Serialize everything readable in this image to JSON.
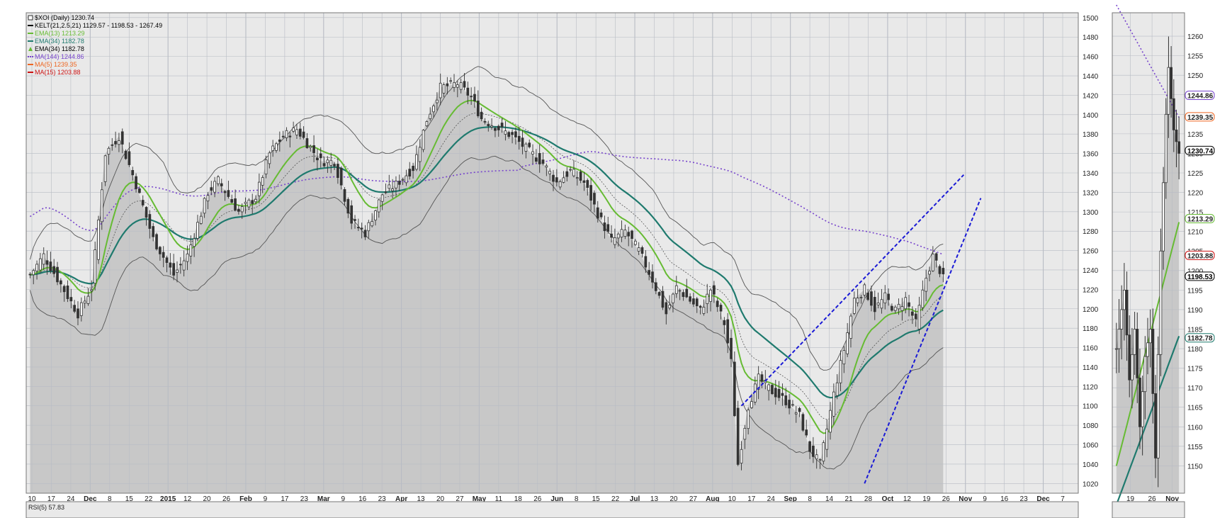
{
  "chart_data": [
    {
      "type": "candlestick",
      "title": "$XOI (Daily) 1230.74",
      "ylim": [
        1010,
        1505
      ],
      "yticks": [
        1020,
        1040,
        1060,
        1080,
        1100,
        1120,
        1140,
        1160,
        1180,
        1200,
        1220,
        1240,
        1260,
        1280,
        1300,
        1320,
        1340,
        1360,
        1380,
        1400,
        1420,
        1440,
        1460,
        1480,
        1500
      ],
      "xticks": [
        {
          "label": "10",
          "bold": false
        },
        {
          "label": "17",
          "bold": false
        },
        {
          "label": "24",
          "bold": false
        },
        {
          "label": "Dec",
          "bold": true
        },
        {
          "label": "8",
          "bold": false
        },
        {
          "label": "15",
          "bold": false
        },
        {
          "label": "22",
          "bold": false
        },
        {
          "label": "2015",
          "bold": true
        },
        {
          "label": "12",
          "bold": false
        },
        {
          "label": "20",
          "bold": false
        },
        {
          "label": "26",
          "bold": false
        },
        {
          "label": "Feb",
          "bold": true
        },
        {
          "label": "9",
          "bold": false
        },
        {
          "label": "17",
          "bold": false
        },
        {
          "label": "23",
          "bold": false
        },
        {
          "label": "Mar",
          "bold": true
        },
        {
          "label": "9",
          "bold": false
        },
        {
          "label": "16",
          "bold": false
        },
        {
          "label": "23",
          "bold": false
        },
        {
          "label": "Apr",
          "bold": true
        },
        {
          "label": "13",
          "bold": false
        },
        {
          "label": "20",
          "bold": false
        },
        {
          "label": "27",
          "bold": false
        },
        {
          "label": "May",
          "bold": true
        },
        {
          "label": "11",
          "bold": false
        },
        {
          "label": "18",
          "bold": false
        },
        {
          "label": "26",
          "bold": false
        },
        {
          "label": "Jun",
          "bold": true
        },
        {
          "label": "8",
          "bold": false
        },
        {
          "label": "15",
          "bold": false
        },
        {
          "label": "22",
          "bold": false
        },
        {
          "label": "Jul",
          "bold": true
        },
        {
          "label": "13",
          "bold": false
        },
        {
          "label": "20",
          "bold": false
        },
        {
          "label": "27",
          "bold": false
        },
        {
          "label": "Aug",
          "bold": true
        },
        {
          "label": "10",
          "bold": false
        },
        {
          "label": "17",
          "bold": false
        },
        {
          "label": "24",
          "bold": false
        },
        {
          "label": "Sep",
          "bold": true
        },
        {
          "label": "8",
          "bold": false
        },
        {
          "label": "14",
          "bold": false
        },
        {
          "label": "21",
          "bold": false
        },
        {
          "label": "28",
          "bold": false
        },
        {
          "label": "Oct",
          "bold": true
        },
        {
          "label": "12",
          "bold": false
        },
        {
          "label": "19",
          "bold": false
        },
        {
          "label": "26",
          "bold": false
        },
        {
          "label": "Nov",
          "bold": true
        },
        {
          "label": "9",
          "bold": false
        },
        {
          "label": "16",
          "bold": false
        },
        {
          "label": "23",
          "bold": false
        },
        {
          "label": "Dec",
          "bold": true
        },
        {
          "label": "7",
          "bold": false
        }
      ],
      "legend": [
        {
          "text": "$XOI (Daily) 1230.74",
          "color": "#000000",
          "style": "box"
        },
        {
          "text": "KELT(21,2.5,21) 1129.57 - 1198.53 - 1267.49",
          "color": "#000000",
          "style": "line"
        },
        {
          "text": "EMA(13) 1213.29",
          "color": "#66bb33",
          "style": "line"
        },
        {
          "text": "EMA(34) 1182.78",
          "color": "#1f7a6e",
          "style": "line"
        },
        {
          "text": "EMA(34) 1182.78",
          "color": "#000000",
          "style": "triangle"
        },
        {
          "text": "MA(144) 1244.86",
          "color": "#7744cc",
          "style": "dot"
        },
        {
          "text": "MA(5) 1239.35",
          "color": "#ee6622",
          "style": "line"
        },
        {
          "text": "MA(15) 1203.88",
          "color": "#cc1111",
          "style": "line"
        }
      ],
      "price_keys": [
        [
          0,
          1235
        ],
        [
          4,
          1255
        ],
        [
          9,
          1225
        ],
        [
          14,
          1195
        ],
        [
          18,
          1222
        ],
        [
          22,
          1360
        ],
        [
          26,
          1378
        ],
        [
          31,
          1328
        ],
        [
          36,
          1272
        ],
        [
          42,
          1235
        ],
        [
          46,
          1255
        ],
        [
          52,
          1320
        ],
        [
          55,
          1332
        ],
        [
          61,
          1300
        ],
        [
          66,
          1315
        ],
        [
          70,
          1360
        ],
        [
          74,
          1378
        ],
        [
          78,
          1385
        ],
        [
          85,
          1352
        ],
        [
          89,
          1352
        ],
        [
          94,
          1290
        ],
        [
          98,
          1278
        ],
        [
          103,
          1318
        ],
        [
          107,
          1328
        ],
        [
          112,
          1345
        ],
        [
          116,
          1395
        ],
        [
          120,
          1428
        ],
        [
          125,
          1432
        ],
        [
          129,
          1418
        ],
        [
          132,
          1396
        ],
        [
          136,
          1388
        ],
        [
          141,
          1378
        ],
        [
          145,
          1365
        ],
        [
          150,
          1350
        ],
        [
          154,
          1330
        ],
        [
          158,
          1342
        ],
        [
          162,
          1330
        ],
        [
          166,
          1298
        ],
        [
          170,
          1270
        ],
        [
          174,
          1280
        ],
        [
          178,
          1260
        ],
        [
          182,
          1230
        ],
        [
          186,
          1195
        ],
        [
          189,
          1222
        ],
        [
          192,
          1212
        ],
        [
          196,
          1198
        ],
        [
          199,
          1220
        ],
        [
          203,
          1185
        ],
        [
          205,
          1145
        ],
        [
          207,
          1040
        ],
        [
          210,
          1100
        ],
        [
          213,
          1128
        ],
        [
          217,
          1115
        ],
        [
          221,
          1105
        ],
        [
          225,
          1090
        ],
        [
          228,
          1055
        ],
        [
          231,
          1040
        ],
        [
          235,
          1112
        ],
        [
          238,
          1158
        ],
        [
          241,
          1210
        ],
        [
          244,
          1220
        ],
        [
          247,
          1200
        ],
        [
          250,
          1212
        ],
        [
          253,
          1198
        ],
        [
          256,
          1210
        ],
        [
          259,
          1185
        ],
        [
          262,
          1232
        ],
        [
          264,
          1254
        ],
        [
          266,
          1240
        ],
        [
          267,
          1231
        ]
      ],
      "annotations": [
        {
          "name": "upper-trendline",
          "from": {
            "x": 208,
            "y": 1100
          },
          "to": {
            "x": 273,
            "y": 1338
          }
        },
        {
          "name": "lower-trendline",
          "from": {
            "x": 244,
            "y": 1020
          },
          "to": {
            "x": 278,
            "y": 1314
          }
        }
      ]
    },
    {
      "type": "candlestick",
      "title": "",
      "ylim": [
        1143,
        1266
      ],
      "yticks": [
        1150,
        1155,
        1160,
        1165,
        1170,
        1175,
        1180,
        1185,
        1190,
        1195,
        1200,
        1205,
        1210,
        1215,
        1220,
        1225,
        1230,
        1235,
        1240,
        1245,
        1250,
        1255,
        1260
      ],
      "xticks": [
        {
          "label": "19",
          "bold": false
        },
        {
          "label": "26",
          "bold": false
        },
        {
          "label": "Nov",
          "bold": true
        }
      ],
      "price_keys": [
        [
          0,
          1180
        ],
        [
          3,
          1195
        ],
        [
          5,
          1172
        ],
        [
          7,
          1185
        ],
        [
          9,
          1160
        ],
        [
          11,
          1178
        ],
        [
          13,
          1185
        ],
        [
          15,
          1152
        ],
        [
          17,
          1205
        ],
        [
          19,
          1240
        ],
        [
          20,
          1252
        ],
        [
          22,
          1236
        ],
        [
          24,
          1230
        ]
      ],
      "tags": [
        {
          "value": "1244.86",
          "y": 1244.86,
          "color": "#7744cc"
        },
        {
          "value": "1239.35",
          "y": 1239.35,
          "color": "#ee6622"
        },
        {
          "value": "1230.74",
          "y": 1230.74,
          "color": "#000000"
        },
        {
          "value": "1213.29",
          "y": 1213.29,
          "color": "#66bb33"
        },
        {
          "value": "1203.88",
          "y": 1203.88,
          "color": "#cc1111"
        },
        {
          "value": "1198.53",
          "y": 1198.53,
          "color": "#000000"
        },
        {
          "value": "1182.78",
          "y": 1182.78,
          "color": "#1f7a6e"
        }
      ]
    }
  ],
  "rsi": {
    "label": "RSI(5) 57.83"
  },
  "colors": {
    "plot_bg": "#e9e9e9",
    "shade": "#c8c8c8",
    "grid": "#b8bcc4",
    "ema13": "#66bb33",
    "ema34": "#1f7a6e",
    "ma144": "#7744cc",
    "trend": "#1a1ad6",
    "candle": "#333333",
    "kelt": "#555555"
  }
}
